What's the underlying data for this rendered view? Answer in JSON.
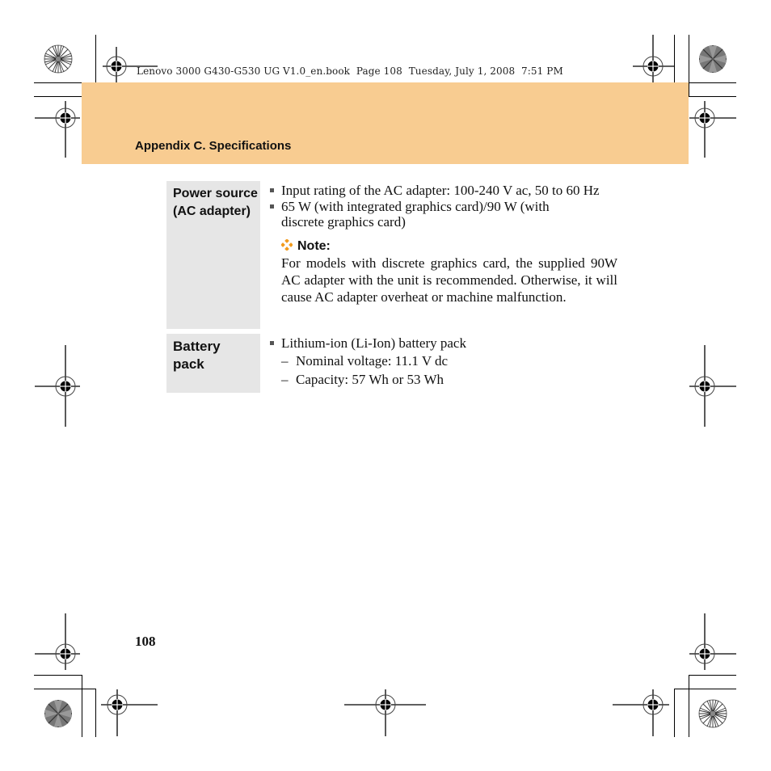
{
  "running_head": "Lenovo 3000 G430-G530 UG V1.0_en.book  Page 108  Tuesday, July 1, 2008  7:51 PM",
  "chapter": {
    "title": "Appendix C. Specifications",
    "band_color": "#f8cc91"
  },
  "specs": [
    {
      "label": [
        "Power source",
        "(AC adapter)"
      ],
      "bullets": [
        "Input rating of the AC adapter: 100-240 V ac, 50 to 60 Hz",
        "65 W (with integrated graphics card)/90 W (with discrete graphics card)"
      ],
      "note": {
        "icon": "note-diamond-icon",
        "title": "Note:",
        "body": "For models with discrete graphics card, the supplied 90W AC adapter with the unit is recommended. Otherwise, it will cause AC adapter overheat or machine malfunction."
      }
    },
    {
      "label": [
        "Battery",
        "pack"
      ],
      "bullets": [
        "Lithium-ion (Li-Ion) battery pack"
      ],
      "subitems": [
        "Nominal voltage: 11.1 V dc",
        "Capacity: 57 Wh or 53 Wh"
      ]
    }
  ],
  "page_number": "108",
  "colors": {
    "label_bg": "#e6e6e6",
    "note_icon": "#f29b1d"
  }
}
